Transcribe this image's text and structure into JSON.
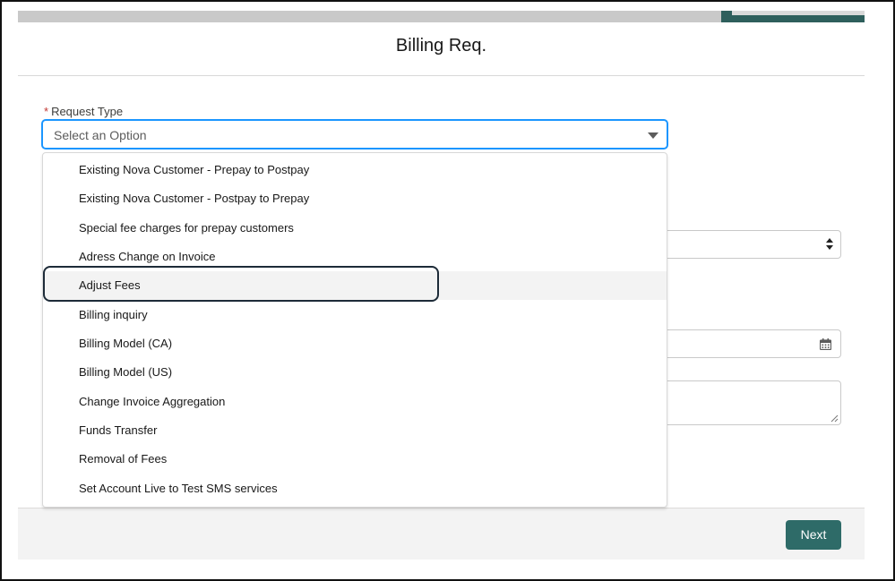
{
  "modal": {
    "title": "Billing Req."
  },
  "request_type": {
    "required_marker": "*",
    "label": "Request Type",
    "placeholder": "Select an Option",
    "options": [
      "Existing Nova Customer - Prepay to Postpay",
      "Existing Nova Customer - Postpay to Prepay",
      "Special fee charges for prepay customers",
      "Adress Change on Invoice",
      "Adjust Fees",
      "Billing inquiry",
      "Billing Model (CA)",
      "Billing Model (US)",
      "Change Invoice Aggregation",
      "Funds Transfer",
      "Removal of Fees",
      "Set Account Live to Test SMS services"
    ],
    "highlighted_option": "Adjust Fees"
  },
  "footer": {
    "next_label": "Next"
  },
  "colors": {
    "accent": "#2e6b68",
    "focus_border": "#1b96ff",
    "required": "#c23934"
  },
  "icons": [
    "chevron-down-icon",
    "up-down-arrows-icon",
    "calendar-icon",
    "resize-grip-icon"
  ]
}
